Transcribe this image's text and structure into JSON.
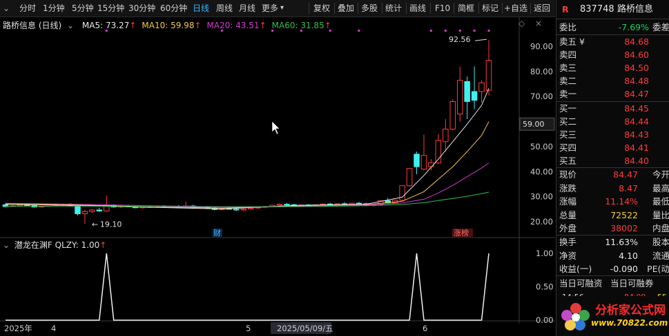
{
  "toolbar": {
    "periods": [
      "分时",
      "1分钟",
      "5分钟",
      "15分钟",
      "30分钟",
      "60分钟",
      "日线",
      "周线",
      "月线",
      "更多"
    ],
    "more_arrow": "▾",
    "active_period": "日线",
    "actions": [
      "复权",
      "叠加",
      "多股",
      "统计",
      "画线",
      "F10",
      "简框",
      "标记",
      "+自选",
      "返回"
    ]
  },
  "main_chart": {
    "stock_label": "路桥信息 (日线)",
    "ma": [
      {
        "name": "MA5",
        "value": "73.27",
        "arrow": "↑",
        "color": "#e8e8e8"
      },
      {
        "name": "MA10",
        "value": "59.98",
        "arrow": "↑",
        "color": "#f2c94c"
      },
      {
        "name": "MA20",
        "value": "43.51",
        "arrow": "↑",
        "color": "#d23ad2"
      },
      {
        "name": "MA60",
        "value": "31.85",
        "arrow": "↑",
        "color": "#2fbf4f"
      }
    ],
    "price_axis": [
      "90.00",
      "80.00",
      "70.00",
      "60.00",
      "50.00",
      "40.00",
      "30.00",
      "20.00"
    ],
    "current_price_tag": "59.00",
    "high_label": "92.56",
    "low_label": "19.10",
    "markers": {
      "cai": "财",
      "zhang": "涨榜"
    }
  },
  "chart_data": {
    "type": "candlestick",
    "ylim": [
      17,
      97
    ],
    "candles": [
      [
        26.8,
        27.4,
        25.8,
        26.1
      ],
      [
        26.1,
        26.6,
        25.9,
        26.4
      ],
      [
        26.4,
        27.0,
        26.0,
        26.8
      ],
      [
        26.8,
        27.2,
        26.2,
        26.5
      ],
      [
        26.5,
        26.9,
        25.7,
        25.9
      ],
      [
        25.9,
        26.4,
        25.6,
        26.2
      ],
      [
        26.2,
        27.0,
        26.0,
        26.9
      ],
      [
        26.9,
        27.3,
        26.4,
        26.6
      ],
      [
        26.6,
        27.1,
        26.3,
        27.0
      ],
      [
        27.0,
        27.4,
        26.1,
        26.3
      ],
      [
        26.3,
        26.8,
        22.5,
        23.2
      ],
      [
        23.2,
        24.8,
        19.1,
        24.1
      ],
      [
        24.1,
        25.0,
        23.5,
        24.7
      ],
      [
        24.7,
        25.5,
        24.0,
        24.3
      ],
      [
        24.3,
        30.5,
        24.0,
        26.6
      ],
      [
        26.6,
        27.0,
        25.6,
        25.9
      ],
      [
        25.9,
        26.5,
        25.5,
        26.2
      ],
      [
        26.2,
        26.8,
        25.8,
        26.0
      ],
      [
        26.0,
        26.4,
        25.4,
        25.6
      ],
      [
        25.6,
        26.2,
        25.2,
        26.0
      ],
      [
        26.0,
        26.5,
        25.6,
        25.8
      ],
      [
        25.8,
        26.3,
        25.5,
        26.1
      ],
      [
        26.1,
        26.6,
        25.7,
        25.9
      ],
      [
        25.9,
        26.4,
        25.4,
        26.2
      ],
      [
        26.2,
        26.7,
        25.8,
        26.0
      ],
      [
        26.0,
        28.0,
        25.8,
        26.3
      ],
      [
        26.3,
        26.8,
        25.6,
        25.7
      ],
      [
        25.7,
        26.2,
        25.3,
        25.9
      ],
      [
        25.9,
        26.3,
        25.2,
        25.4
      ],
      [
        25.4,
        25.8,
        24.5,
        24.9
      ],
      [
        24.9,
        25.6,
        24.6,
        25.3
      ],
      [
        25.3,
        25.8,
        24.8,
        25.0
      ],
      [
        25.0,
        25.6,
        24.3,
        24.7
      ],
      [
        24.7,
        25.3,
        24.4,
        25.1
      ],
      [
        25.1,
        25.7,
        24.8,
        25.5
      ],
      [
        25.5,
        26.0,
        25.1,
        25.8
      ],
      [
        25.8,
        26.3,
        25.4,
        26.1
      ],
      [
        26.1,
        26.8,
        25.8,
        26.6
      ],
      [
        26.6,
        27.3,
        26.2,
        27.0
      ],
      [
        27.0,
        27.5,
        26.4,
        26.8
      ],
      [
        26.8,
        27.2,
        26.3,
        26.5
      ],
      [
        26.5,
        26.9,
        26.0,
        26.7
      ],
      [
        26.7,
        27.1,
        26.2,
        26.4
      ],
      [
        26.4,
        26.9,
        26.1,
        26.8
      ],
      [
        26.8,
        27.3,
        26.4,
        27.1
      ],
      [
        27.1,
        27.6,
        26.6,
        26.9
      ],
      [
        26.9,
        27.4,
        26.5,
        27.2
      ],
      [
        27.2,
        27.8,
        26.8,
        27.0
      ],
      [
        27.0,
        27.5,
        26.5,
        27.4
      ],
      [
        27.4,
        28.0,
        26.9,
        27.2
      ],
      [
        27.2,
        27.6,
        26.2,
        26.5
      ],
      [
        26.5,
        27.0,
        26.1,
        26.9
      ],
      [
        26.9,
        28.6,
        26.6,
        28.4
      ],
      [
        28.4,
        29.5,
        27.2,
        27.6
      ],
      [
        27.6,
        28.8,
        27.3,
        28.6
      ],
      [
        28.6,
        34.5,
        28.4,
        34.4
      ],
      [
        34.4,
        41.3,
        34.0,
        41.3
      ],
      [
        47.0,
        48.0,
        39.0,
        42.0
      ],
      [
        41.0,
        54.8,
        40.5,
        46.5
      ],
      [
        42.0,
        45.0,
        40.5,
        43.5
      ],
      [
        43.5,
        55.0,
        43.0,
        52.5
      ],
      [
        52.0,
        61.0,
        48.0,
        57.0
      ],
      [
        57.0,
        69.0,
        56.5,
        68.0
      ],
      [
        63.0,
        82.0,
        60.0,
        76.5
      ],
      [
        76.0,
        78.0,
        61.0,
        68.0
      ],
      [
        72.0,
        82.0,
        65.0,
        68.5
      ],
      [
        72.0,
        76.5,
        67.5,
        75.5
      ],
      [
        72.5,
        92.56,
        70.5,
        84.47
      ]
    ],
    "ma_series": {
      "MA5": [
        [
          0,
          27.0
        ],
        [
          10,
          26.5
        ],
        [
          20,
          25.8
        ],
        [
          30,
          25.1
        ],
        [
          40,
          26.5
        ],
        [
          50,
          27.0
        ],
        [
          55,
          29.8
        ],
        [
          58,
          38.5
        ],
        [
          60,
          45.0
        ],
        [
          62,
          52.0
        ],
        [
          64,
          59.0
        ],
        [
          66,
          66.5
        ],
        [
          67,
          73.27
        ]
      ],
      "MA10": [
        [
          0,
          27.2
        ],
        [
          10,
          26.7
        ],
        [
          20,
          26.0
        ],
        [
          30,
          25.5
        ],
        [
          40,
          26.2
        ],
        [
          50,
          26.8
        ],
        [
          55,
          28.2
        ],
        [
          58,
          32.0
        ],
        [
          60,
          37.0
        ],
        [
          62,
          42.0
        ],
        [
          64,
          48.0
        ],
        [
          66,
          54.5
        ],
        [
          67,
          59.98
        ]
      ],
      "MA20": [
        [
          0,
          27.4
        ],
        [
          10,
          27.0
        ],
        [
          20,
          26.4
        ],
        [
          30,
          26.0
        ],
        [
          40,
          26.1
        ],
        [
          50,
          26.7
        ],
        [
          55,
          27.5
        ],
        [
          58,
          29.0
        ],
        [
          60,
          31.5
        ],
        [
          62,
          34.5
        ],
        [
          64,
          38.0
        ],
        [
          66,
          41.5
        ],
        [
          67,
          43.51
        ]
      ],
      "MA60": [
        [
          0,
          26.2
        ],
        [
          10,
          26.3
        ],
        [
          20,
          26.0
        ],
        [
          30,
          25.9
        ],
        [
          40,
          26.0
        ],
        [
          50,
          26.4
        ],
        [
          55,
          26.9
        ],
        [
          58,
          27.6
        ],
        [
          60,
          28.5
        ],
        [
          62,
          29.3
        ],
        [
          64,
          30.2
        ],
        [
          66,
          31.2
        ],
        [
          67,
          31.85
        ]
      ]
    },
    "indicator": {
      "name": "潜龙在渊F",
      "param": "QLZY",
      "value": "1.00",
      "arrow": "↑",
      "ylim": [
        0,
        1
      ],
      "axis": [
        "1.00",
        "0.50",
        "0.00"
      ],
      "values_by_index": {
        "14": 1,
        "57": 1,
        "67": 1
      }
    },
    "x_labels": [
      "2025年",
      "4",
      "5",
      "2025/05/09/五",
      "6"
    ]
  },
  "right_panel": {
    "code": "837748",
    "name": "路桥信息",
    "committee": {
      "label": "委比",
      "value": "-7.69%",
      "label2": "委差"
    },
    "asks": [
      {
        "label": "卖五 ¥",
        "price": "84.68"
      },
      {
        "label": "卖四",
        "price": "84.60"
      },
      {
        "label": "卖三",
        "price": "84.50"
      },
      {
        "label": "卖二",
        "price": "84.48"
      },
      {
        "label": "卖一",
        "price": "84.47"
      }
    ],
    "bids": [
      {
        "label": "买一",
        "price": "84.45"
      },
      {
        "label": "买二",
        "price": "84.44"
      },
      {
        "label": "买三",
        "price": "84.43"
      },
      {
        "label": "买四",
        "price": "84.41"
      },
      {
        "label": "买五",
        "price": "84.40"
      }
    ],
    "quote": [
      {
        "l": "现价",
        "v": "84.47",
        "vc": "red",
        "r": "今开"
      },
      {
        "l": "涨跌",
        "v": "8.47",
        "vc": "red",
        "r": "最高"
      },
      {
        "l": "涨幅",
        "v": "11.14%",
        "vc": "red",
        "r": "最低"
      },
      {
        "l": "总量",
        "v": "72522",
        "vc": "yellow",
        "r": "量比"
      },
      {
        "l": "外盘",
        "v": "38002",
        "vc": "red",
        "r": "内盘"
      }
    ],
    "stats": [
      {
        "l": "换手",
        "v": "11.63%",
        "r": "股本"
      },
      {
        "l": "净资",
        "v": "4.10",
        "r": "流通"
      },
      {
        "l": "收益(一)",
        "v": "-0.090",
        "r": "PE(动"
      }
    ],
    "margin": {
      "a": "当日可融资",
      "b": "当日可融券"
    },
    "tick": {
      "time": "14:56",
      "price": "84.09",
      "vol": "55"
    },
    "watermark": {
      "title": "分析家公式网",
      "url": "www.70822.com"
    }
  }
}
